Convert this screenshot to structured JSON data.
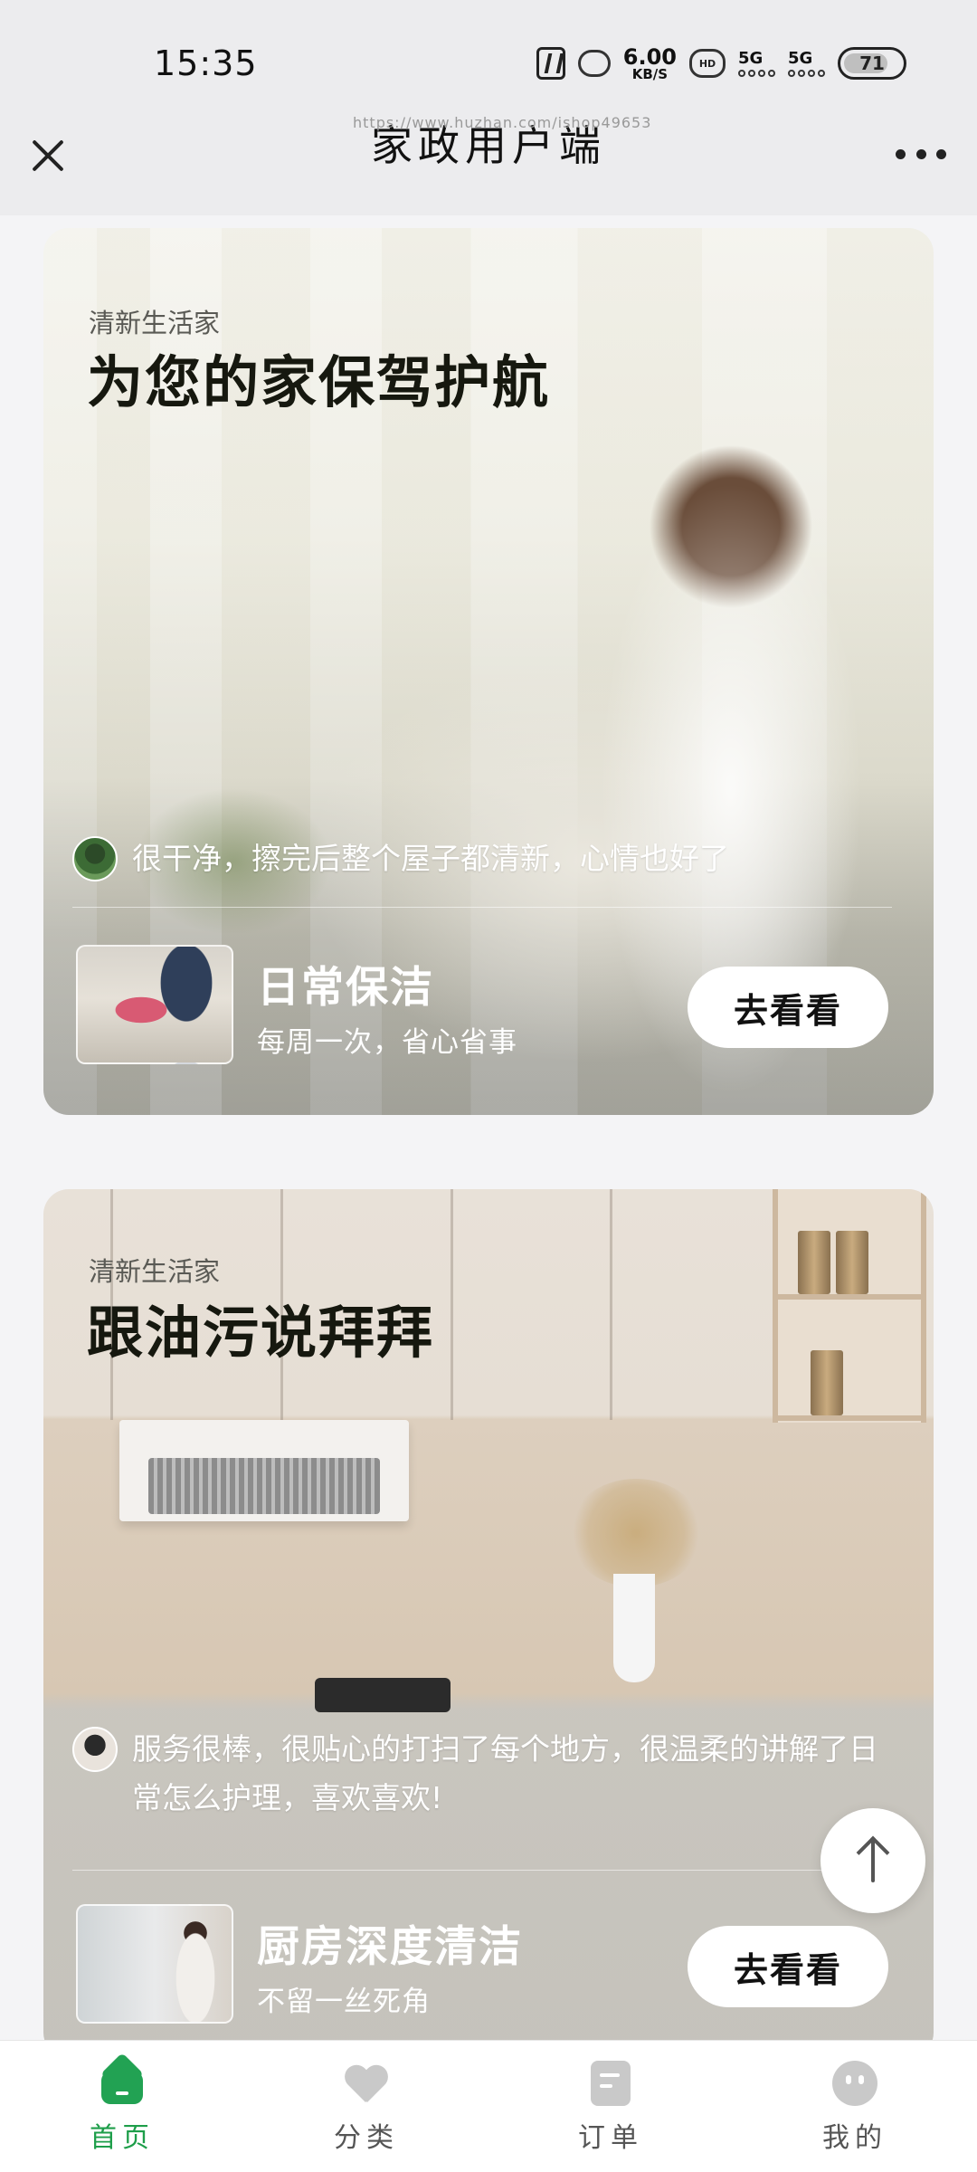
{
  "status_bar": {
    "time": "15:35",
    "network_speed": "6.00",
    "network_speed_unit": "KB/S",
    "hd_label": "HD",
    "signal_1": "5G",
    "signal_2": "5G",
    "battery": "71"
  },
  "nav": {
    "url": "https://www.huzhan.com/ishop49653",
    "title": "家政用户端"
  },
  "cards": [
    {
      "tag": "清新生活家",
      "headline": "为您的家保驾护航",
      "review": "很干净，擦完后整个屋子都清新，心情也好了",
      "service_name": "日常保洁",
      "service_desc": "每周一次，省心省事",
      "button": "去看看"
    },
    {
      "tag": "清新生活家",
      "headline": "跟油污说拜拜",
      "review": "服务很棒，很贴心的打扫了每个地方，很温柔的讲解了日常怎么护理，喜欢喜欢!",
      "service_name": "厨房深度清洁",
      "service_desc": "不留一丝死角",
      "button": "去看看"
    }
  ],
  "tab_bar": {
    "active": "home",
    "items": [
      {
        "label": "首页",
        "icon": "home-icon"
      },
      {
        "label": "分类",
        "icon": "heart-icon"
      },
      {
        "label": "订单",
        "icon": "order-icon"
      },
      {
        "label": "我的",
        "icon": "profile-icon"
      }
    ]
  },
  "colors": {
    "accent": "#22a253",
    "button_bg": "#ffffff",
    "page_bg": "#f4f4f6"
  }
}
